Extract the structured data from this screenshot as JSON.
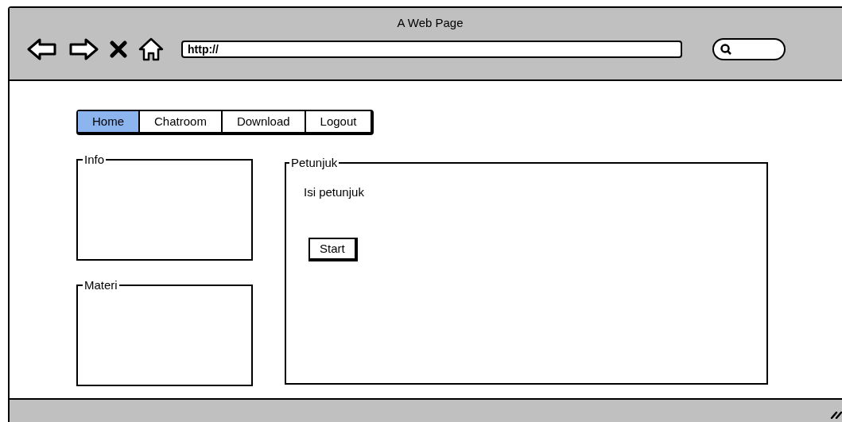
{
  "window": {
    "title": "A Web Page"
  },
  "address_bar": {
    "value": "http://"
  },
  "nav_tabs": [
    {
      "label": "Home",
      "selected": true
    },
    {
      "label": "Chatroom",
      "selected": false
    },
    {
      "label": "Download",
      "selected": false
    },
    {
      "label": "Logout",
      "selected": false
    }
  ],
  "sidebar_groups": [
    {
      "title": "Info"
    },
    {
      "title": "Materi"
    }
  ],
  "main_group": {
    "title": "Petunjuk",
    "text": "Isi petunjuk",
    "button": "Start"
  }
}
